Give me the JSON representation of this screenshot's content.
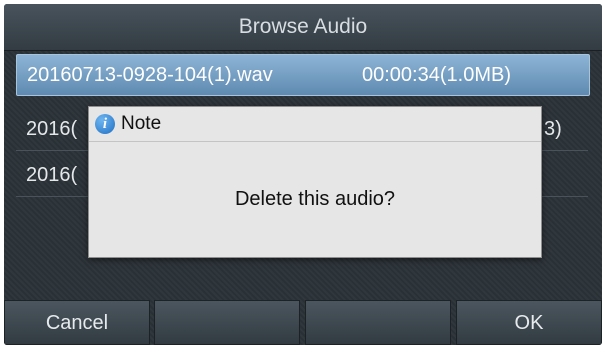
{
  "title": "Browse Audio",
  "files": [
    {
      "name": "20160713-0928-104(1).wav",
      "info": "00:00:34(1.0MB)",
      "selected": true
    },
    {
      "name": "2016(",
      "info": "3)",
      "selected": false
    },
    {
      "name": "2016(",
      "info": "",
      "selected": false
    }
  ],
  "dialog": {
    "title": "Note",
    "message": "Delete this audio?",
    "icon": "info-icon"
  },
  "softkeys": [
    "Cancel",
    "",
    "",
    "OK"
  ],
  "colors": {
    "screen_bg": "#2b3238",
    "selected_row": "#6f98bd",
    "dialog_bg": "#e6e6e6"
  }
}
